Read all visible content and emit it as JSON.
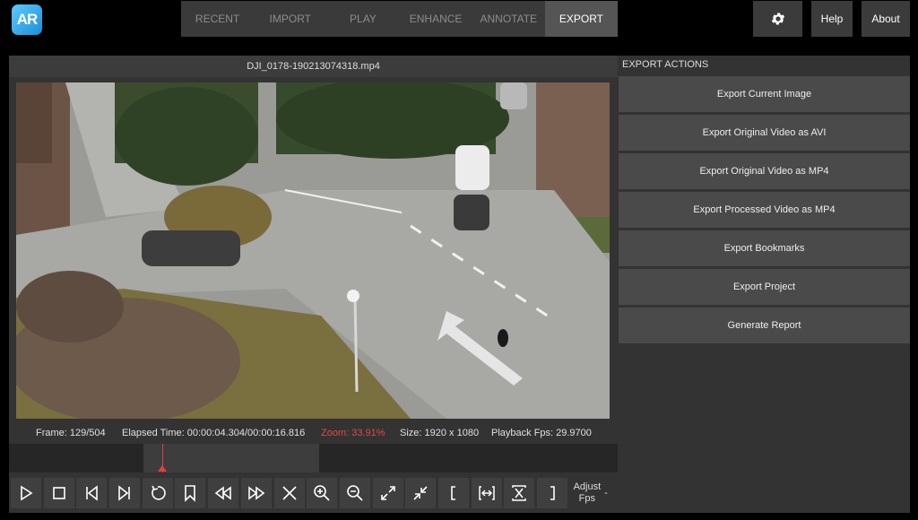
{
  "app": {
    "logo_text": "AR"
  },
  "tabs": [
    {
      "label": "RECENT",
      "active": false
    },
    {
      "label": "IMPORT",
      "active": false
    },
    {
      "label": "PLAY",
      "active": false
    },
    {
      "label": "ENHANCE",
      "active": false
    },
    {
      "label": "ANNOTATE",
      "active": false
    },
    {
      "label": "EXPORT",
      "active": true
    }
  ],
  "topbar": {
    "settings_icon": "gear-icon",
    "help_label": "Help",
    "about_label": "About"
  },
  "video": {
    "filename": "DJI_0178-190213074318.mp4",
    "info": {
      "frame": "Frame: 129/504",
      "elapsed": "Elapsed Time: 00:00:04.304/00:00:16.816",
      "zoom": "Zoom: 33.91%",
      "size": "Size: 1920 x 1080",
      "fps": "Playback Fps: 29.9700"
    },
    "playback_progress": 0.256
  },
  "controls": [
    {
      "name": "play-icon"
    },
    {
      "name": "stop-icon"
    },
    {
      "name": "step-back-icon"
    },
    {
      "name": "step-forward-icon"
    },
    {
      "name": "replay-icon"
    },
    {
      "name": "bookmark-icon"
    },
    {
      "name": "rewind-icon"
    },
    {
      "name": "fast-forward-icon"
    },
    {
      "name": "clear-icon"
    },
    {
      "name": "zoom-in-icon"
    },
    {
      "name": "zoom-out-icon"
    },
    {
      "name": "expand-icon"
    },
    {
      "name": "collapse-icon"
    },
    {
      "name": "mark-in-icon"
    },
    {
      "name": "fit-width-icon"
    },
    {
      "name": "fit-height-icon"
    },
    {
      "name": "mark-out-icon"
    }
  ],
  "adjust_fps": {
    "line1": "Adjust",
    "line2": "Fps",
    "suffix": "-"
  },
  "export": {
    "header": "EXPORT ACTIONS",
    "actions": [
      "Export Current Image",
      "Export Original Video as AVI",
      "Export Original Video as MP4",
      "Export Processed Video as MP4",
      "Export Bookmarks",
      "Export Project",
      "Generate Report"
    ]
  }
}
